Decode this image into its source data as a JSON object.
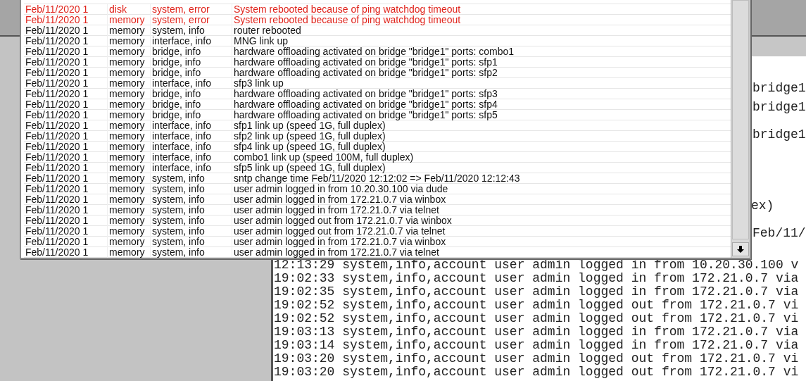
{
  "log_window": {
    "rows": [
      {
        "time": "Feb/11/2020 1",
        "buffer": "disk",
        "topics": "system, error",
        "message": "System rebooted because of ping watchdog timeout",
        "kind": "error"
      },
      {
        "time": "Feb/11/2020 1",
        "buffer": "memory",
        "topics": "system, error",
        "message": "System rebooted because of ping watchdog timeout",
        "kind": "error"
      },
      {
        "time": "Feb/11/2020 1",
        "buffer": "memory",
        "topics": "system, info",
        "message": "router rebooted",
        "kind": "info"
      },
      {
        "time": "Feb/11/2020 1",
        "buffer": "memory",
        "topics": "interface, info",
        "message": "MNG link up",
        "kind": "info"
      },
      {
        "time": "Feb/11/2020 1",
        "buffer": "memory",
        "topics": "bridge, info",
        "message": "hardware offloading activated on bridge \"bridge1\" ports: combo1",
        "kind": "info"
      },
      {
        "time": "Feb/11/2020 1",
        "buffer": "memory",
        "topics": "bridge, info",
        "message": "hardware offloading activated on bridge \"bridge1\" ports: sfp1",
        "kind": "info"
      },
      {
        "time": "Feb/11/2020 1",
        "buffer": "memory",
        "topics": "bridge, info",
        "message": "hardware offloading activated on bridge \"bridge1\" ports: sfp2",
        "kind": "info"
      },
      {
        "time": "Feb/11/2020 1",
        "buffer": "memory",
        "topics": "interface, info",
        "message": "sfp3 link up",
        "kind": "info"
      },
      {
        "time": "Feb/11/2020 1",
        "buffer": "memory",
        "topics": "bridge, info",
        "message": "hardware offloading activated on bridge \"bridge1\" ports: sfp3",
        "kind": "info"
      },
      {
        "time": "Feb/11/2020 1",
        "buffer": "memory",
        "topics": "bridge, info",
        "message": "hardware offloading activated on bridge \"bridge1\" ports: sfp4",
        "kind": "info"
      },
      {
        "time": "Feb/11/2020 1",
        "buffer": "memory",
        "topics": "bridge, info",
        "message": "hardware offloading activated on bridge \"bridge1\" ports: sfp5",
        "kind": "info"
      },
      {
        "time": "Feb/11/2020 1",
        "buffer": "memory",
        "topics": "interface, info",
        "message": "sfp1 link up (speed 1G, full duplex)",
        "kind": "info"
      },
      {
        "time": "Feb/11/2020 1",
        "buffer": "memory",
        "topics": "interface, info",
        "message": "sfp2 link up (speed 1G, full duplex)",
        "kind": "info"
      },
      {
        "time": "Feb/11/2020 1",
        "buffer": "memory",
        "topics": "interface, info",
        "message": "sfp4 link up (speed 1G, full duplex)",
        "kind": "info"
      },
      {
        "time": "Feb/11/2020 1",
        "buffer": "memory",
        "topics": "interface, info",
        "message": "combo1 link up (speed 100M, full duplex)",
        "kind": "info"
      },
      {
        "time": "Feb/11/2020 1",
        "buffer": "memory",
        "topics": "interface, info",
        "message": "sfp5 link up (speed 1G, full duplex)",
        "kind": "info"
      },
      {
        "time": "Feb/11/2020 1",
        "buffer": "memory",
        "topics": "system, info",
        "message": "sntp change time Feb/11/2020 12:12:02 => Feb/11/2020 12:12:43",
        "kind": "info"
      },
      {
        "time": "Feb/11/2020 1",
        "buffer": "memory",
        "topics": "system, info",
        "message": "user admin logged in from 10.20.30.100 via dude",
        "kind": "info"
      },
      {
        "time": "Feb/11/2020 1",
        "buffer": "memory",
        "topics": "system, info",
        "message": "user admin logged in from 172.21.0.7 via winbox",
        "kind": "info"
      },
      {
        "time": "Feb/11/2020 1",
        "buffer": "memory",
        "topics": "system, info",
        "message": "user admin logged in from 172.21.0.7 via telnet",
        "kind": "info"
      },
      {
        "time": "Feb/11/2020 1",
        "buffer": "memory",
        "topics": "system, info",
        "message": "user admin logged out from 172.21.0.7 via winbox",
        "kind": "info"
      },
      {
        "time": "Feb/11/2020 1",
        "buffer": "memory",
        "topics": "system, info",
        "message": "user admin logged out from 172.21.0.7 via telnet",
        "kind": "info"
      },
      {
        "time": "Feb/11/2020 1",
        "buffer": "memory",
        "topics": "system, info",
        "message": "user admin logged in from 172.21.0.7 via winbox",
        "kind": "info"
      },
      {
        "time": "Feb/11/2020 1",
        "buffer": "memory",
        "topics": "system, info",
        "message": "user admin logged in from 172.21.0.7 via telnet",
        "kind": "info"
      }
    ]
  },
  "terminal": {
    "fragments": [
      "bridge1",
      "bridge1",
      "bridge1",
      "ex)",
      "Feb/11/"
    ],
    "lines": [
      "12:13:29 system,info,account user admin logged in from 10.20.30.100 v",
      "19:02:33 system,info,account user admin logged in from 172.21.0.7 via",
      "19:02:35 system,info,account user admin logged in from 172.21.0.7 via",
      "19:02:52 system,info,account user admin logged out from 172.21.0.7 vi",
      "19:02:52 system,info,account user admin logged out from 172.21.0.7 vi",
      "19:03:13 system,info,account user admin logged in from 172.21.0.7 via",
      "19:03:14 system,info,account user admin logged in from 172.21.0.7 via",
      "19:03:20 system,info,account user admin logged out from 172.21.0.7 vi",
      "19:03:20 system,info,account user admin logged out from 172.21.0.7 vi"
    ]
  }
}
